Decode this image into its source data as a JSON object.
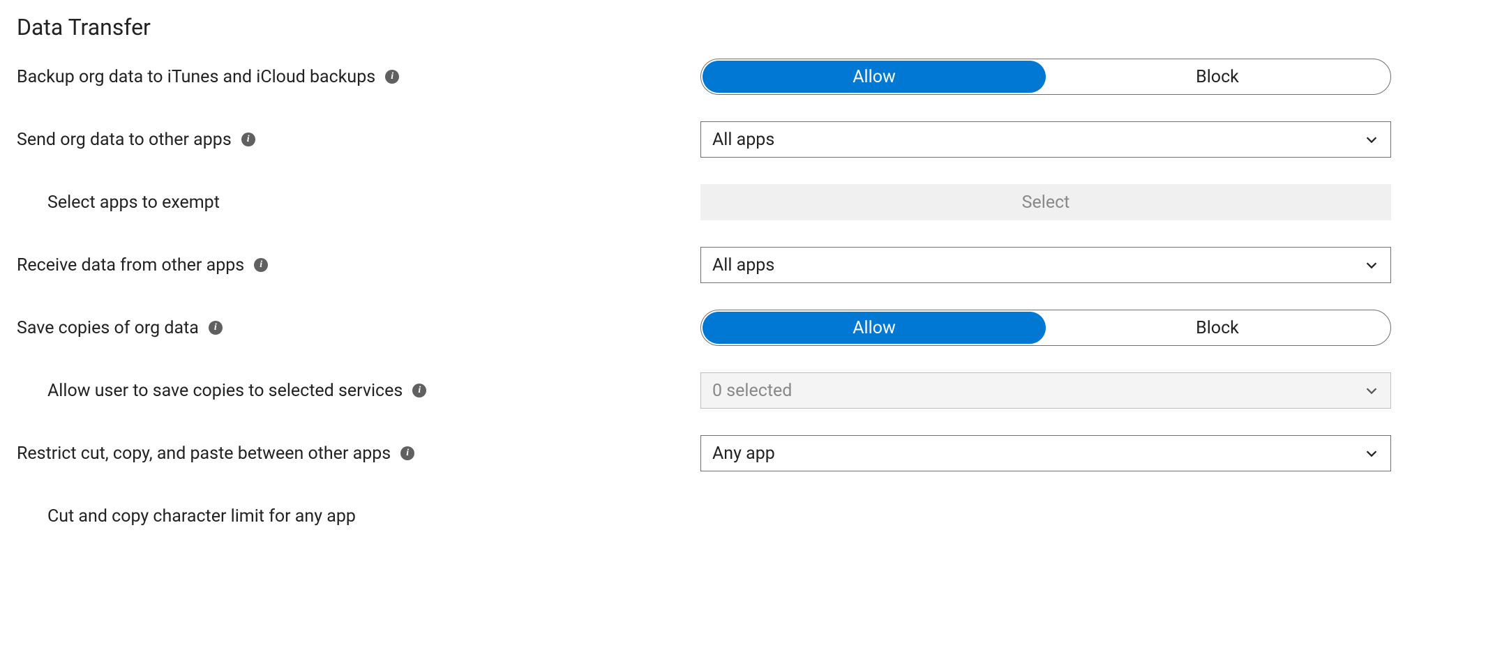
{
  "section": {
    "title": "Data Transfer"
  },
  "rows": {
    "backup": {
      "label": "Backup org data to iTunes and iCloud backups",
      "options": {
        "allow": "Allow",
        "block": "Block"
      },
      "selected": "allow"
    },
    "send": {
      "label": "Send org data to other apps",
      "value": "All apps"
    },
    "exempt": {
      "label": "Select apps to exempt",
      "button": "Select"
    },
    "receive": {
      "label": "Receive data from other apps",
      "value": "All apps"
    },
    "save": {
      "label": "Save copies of org data",
      "options": {
        "allow": "Allow",
        "block": "Block"
      },
      "selected": "allow"
    },
    "save_services": {
      "label": "Allow user to save copies to selected services",
      "value": "0 selected"
    },
    "restrict": {
      "label": "Restrict cut, copy, and paste between other apps",
      "value": "Any app"
    },
    "char_limit": {
      "label": "Cut and copy character limit for any app"
    }
  }
}
